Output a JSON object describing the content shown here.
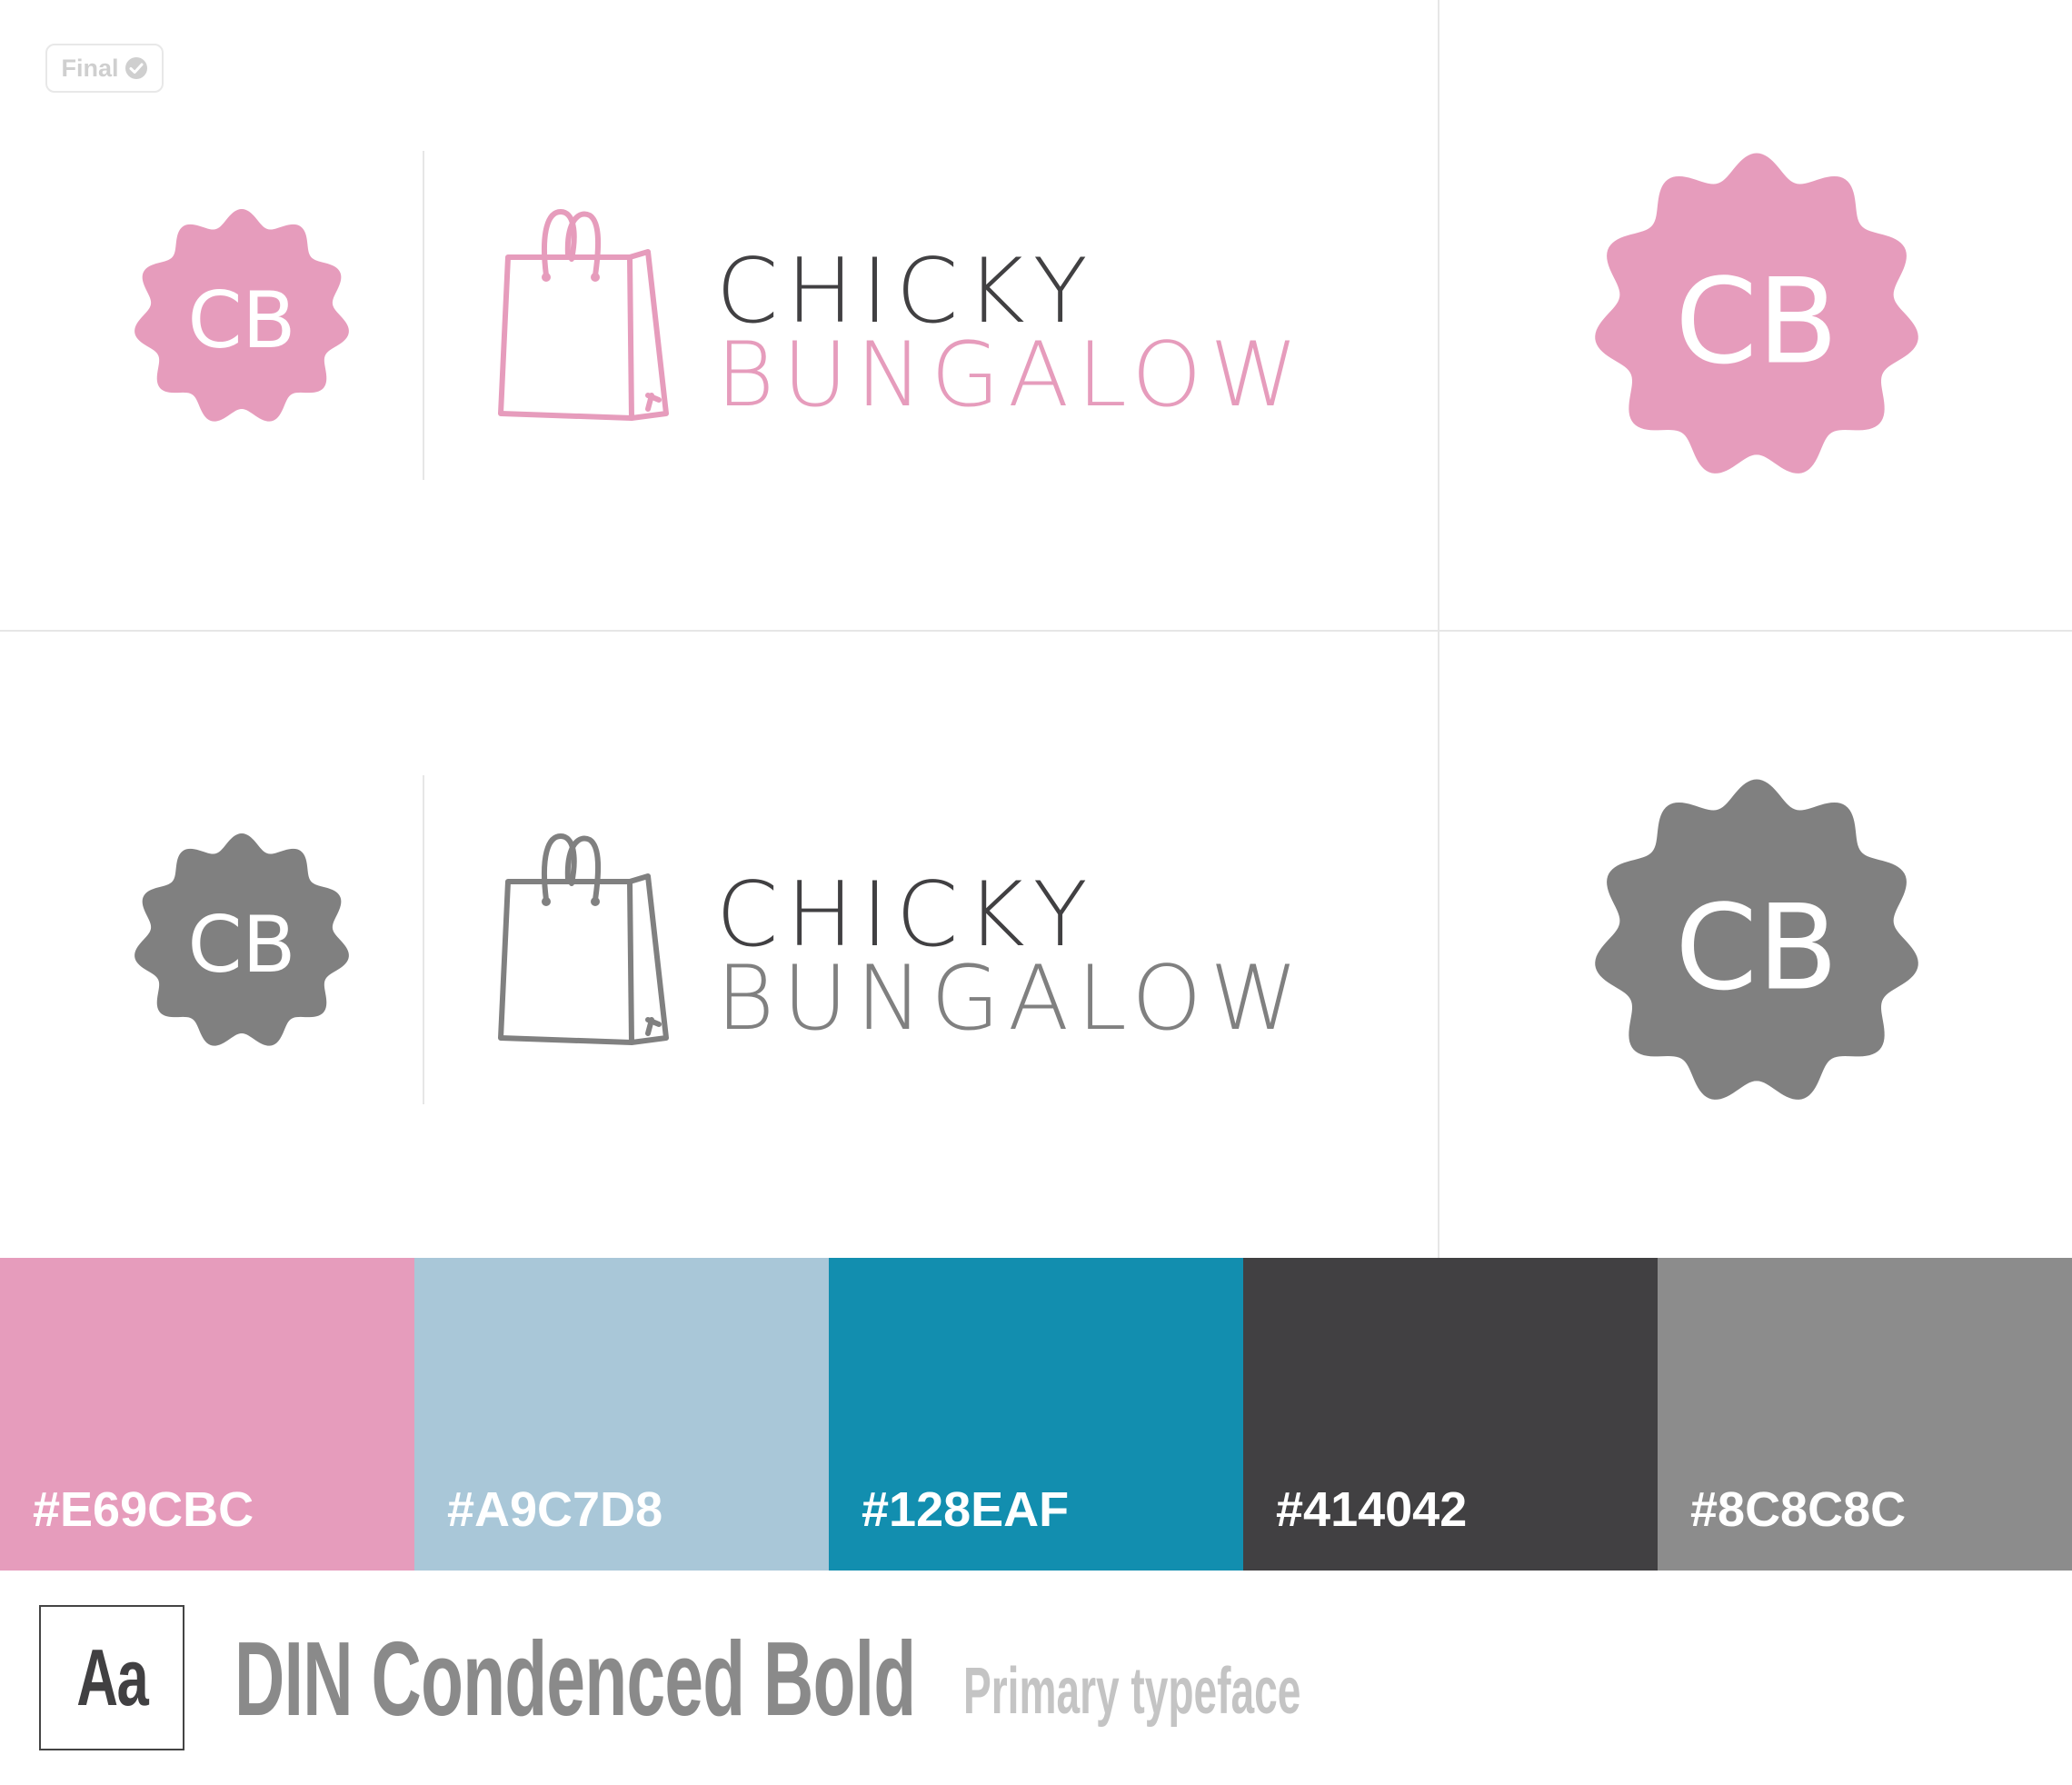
{
  "status_badge": {
    "label": "Final"
  },
  "brand": {
    "badge_initials": "CB",
    "wordmark_line1": "CHICKY",
    "wordmark_line2": "BUNGALOW"
  },
  "variants": [
    {
      "name": "color",
      "accent": "#E69CBC",
      "line1_color": "#414042"
    },
    {
      "name": "mono",
      "accent": "#808080",
      "line1_color": "#414042"
    }
  ],
  "palette": [
    {
      "hex": "#E69CBC",
      "label": "#E69CBC"
    },
    {
      "hex": "#A9C7D8",
      "label": "#A9C7D8"
    },
    {
      "hex": "#128EAF",
      "label": "#128EAF"
    },
    {
      "hex": "#414042",
      "label": "#414042"
    },
    {
      "hex": "#8C8C8C",
      "label": "#8C8C8C"
    }
  ],
  "typeface": {
    "sample": "Aa",
    "name": "DIN Condenced Bold",
    "role": "Primary typeface"
  }
}
